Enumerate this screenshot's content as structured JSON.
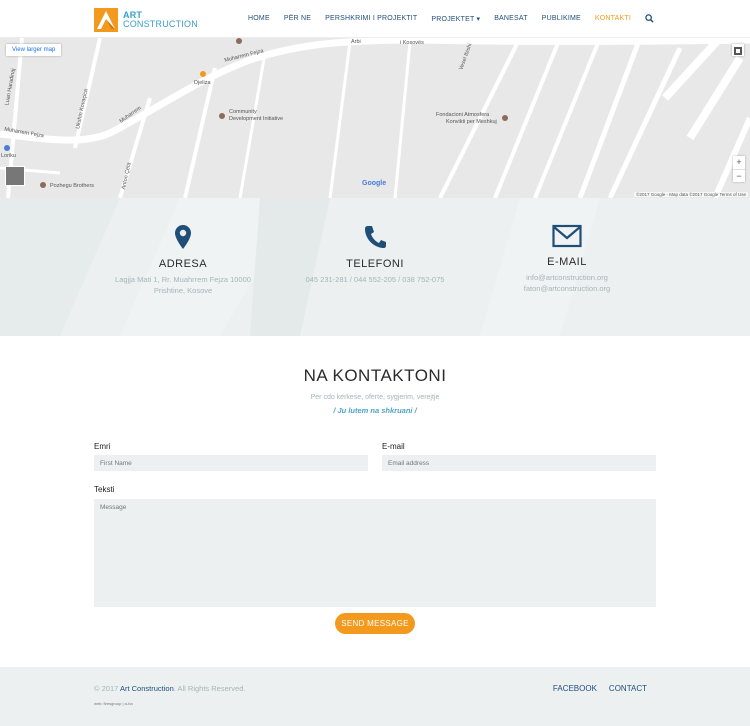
{
  "header": {
    "logo_line1": "ART",
    "logo_line2": "CONSTRUCTION",
    "nav": [
      {
        "label": "HOME",
        "active": false
      },
      {
        "label": "PËR NE",
        "active": false
      },
      {
        "label": "PERSHKRIMI I PROJEKTIT",
        "active": false
      },
      {
        "label": "PROJEKTET ▾",
        "active": false
      },
      {
        "label": "BANESAT",
        "active": false
      },
      {
        "label": "PUBLIKIME",
        "active": false
      },
      {
        "label": "KONTAKTI",
        "active": true
      }
    ],
    "search_icon": "search-icon"
  },
  "map": {
    "larger_map_label": "View larger map",
    "labels": {
      "muharrem_fejza_top": "Muharrem Fejza",
      "muharrem_fejza_left": "Muharrem Fejza",
      "arbi": "Arbi",
      "kosoves": "i Kosovës",
      "djeliza": "Djeliza",
      "community": "Community",
      "development": "Development Initiative",
      "fondacion": "Fondacioni Atmosfera",
      "konvikti": "Konvikti per Meshkuj",
      "loriku": "Loriku",
      "pozhegu": "Pozhegu Brothers",
      "ukshin": "Ukshin Kovaçica",
      "street_left": "Luan Haradinaj",
      "muharrem_mid": "Muharrem",
      "anton_ceta": "Anton Çeta",
      "vesel": "Vesel Ibishi"
    },
    "google": "Google",
    "attribution": "©2017 Google - Map data ©2017 Google   Terms of Use",
    "zoom_in": "+",
    "zoom_out": "−"
  },
  "info": {
    "address": {
      "title": "ADRESA",
      "line1": "Lagjja Mati 1, Rr. Muahrrem Fejza 10000",
      "line2": "Prishtine, Kosove",
      "icon": "map-pin-icon"
    },
    "phone": {
      "title": "TELEFONI",
      "line1": "045 231-281 / 044 552-205 / 038 752-075",
      "icon": "phone-icon"
    },
    "email": {
      "title": "E-MAIL",
      "line1": "info@artconstruction.org",
      "line2": "faton@artconstruction.org",
      "icon": "envelope-icon"
    }
  },
  "contact": {
    "title": "NA KONTAKTONI",
    "subtitle": "Per cdo kerkese, oferte, sygjerim, verejtje",
    "subtitle2": "/ Ju lutem na shkruani /",
    "name_label": "Emri",
    "name_placeholder": "First Name",
    "email_label": "E-mail",
    "email_placeholder": "Email address",
    "text_label": "Teksti",
    "message_placeholder": "Message",
    "send_label": "SEND MESSAGE"
  },
  "footer": {
    "copyright_prefix": "© 2017",
    "copyright_brand": "Art Construction",
    "copyright_suffix": ". All Rights Reserved.",
    "credit": "web: firesgroup | a-ha",
    "links": [
      "FACEBOOK",
      "CONTACT"
    ]
  },
  "colors": {
    "accent": "#f39a1e",
    "navy": "#1f4e79",
    "light_bg": "#ecf0f1",
    "muted_text": "#a6b4b8"
  }
}
